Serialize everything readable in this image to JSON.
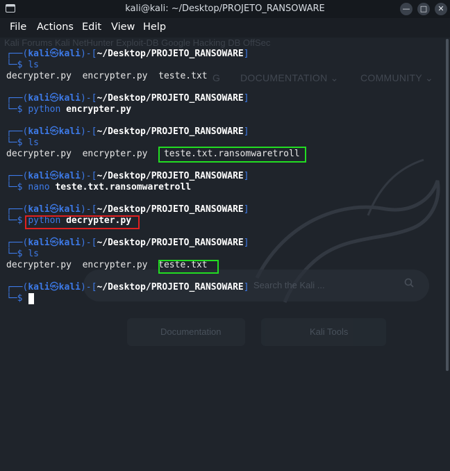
{
  "window": {
    "title": "kali@kali: ~/Desktop/PROJETO_RANSOWARE",
    "minimize_glyph": "—",
    "maximize_glyph": "□",
    "close_glyph": "✕"
  },
  "menu": [
    "File",
    "Actions",
    "Edit",
    "View",
    "Help"
  ],
  "background": {
    "bookmarks": "Kali Forums     Kali NetHunter     Exploit-DB     Google Hacking DB     OffSec",
    "nav_left": "G",
    "nav_documentation": "DOCUMENTATION ⌄",
    "nav_community": "COMMUNITY ⌄",
    "search_placeholder": "Search the Kali ...",
    "btn_documentation": "Documentation",
    "btn_tools": "Kali Tools"
  },
  "prompt": {
    "user": "kali",
    "at": "㉿",
    "host": "kali",
    "path": "~/Desktop/PROJETO_RANSOWARE",
    "dollar": "$"
  },
  "terminal": {
    "cmd1": "ls",
    "out1": [
      "decrypter.py",
      "encrypter.py",
      "teste.txt"
    ],
    "cmd2_prog": "python",
    "cmd2_arg": "encrypter.py",
    "cmd3": "ls",
    "out3": [
      "decrypter.py",
      "encrypter.py",
      "teste.txt.ransomwaretroll"
    ],
    "cmd4_prog": "nano",
    "cmd4_arg": "teste.txt.ransomwaretroll",
    "cmd5_prog": "python",
    "cmd5_arg": "decrypter.py",
    "cmd6": "ls",
    "out6": [
      "decrypter.py",
      "encrypter.py",
      "teste.txt"
    ]
  },
  "colors": {
    "prompt_blue": "#3d7ae8",
    "highlight_green": "#22dd22",
    "highlight_red": "#e02020"
  }
}
